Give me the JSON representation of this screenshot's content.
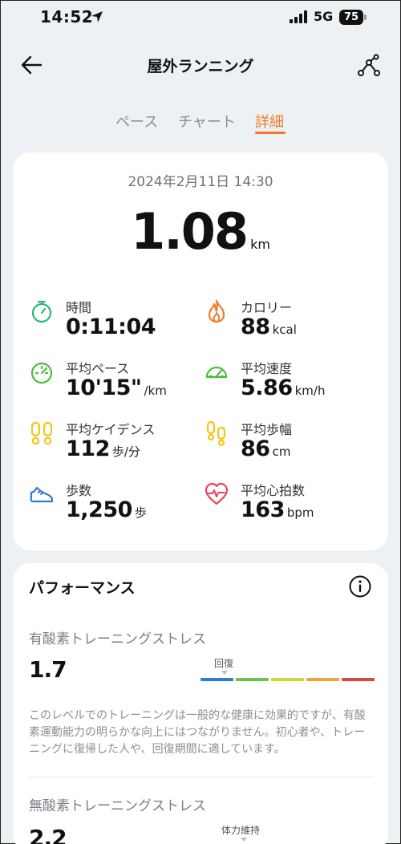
{
  "status_bar": {
    "time": "14:52",
    "network": "5G",
    "battery": "75"
  },
  "header": {
    "title": "屋外ランニング"
  },
  "tabs": [
    {
      "label": "ペース",
      "active": false
    },
    {
      "label": "チャート",
      "active": false
    },
    {
      "label": "詳細",
      "active": true
    }
  ],
  "summary": {
    "date": "2024年2月11日 14:30",
    "distance": "1.08",
    "distance_unit": "km"
  },
  "metrics": [
    {
      "label": "時間",
      "value": "0:11:04",
      "unit": "",
      "icon": "stopwatch-icon",
      "color": "#2bb673"
    },
    {
      "label": "カロリー",
      "value": "88",
      "unit": "kcal",
      "icon": "flame-icon",
      "color": "#f07a2a"
    },
    {
      "label": "平均ペース",
      "value": "10'15\"",
      "unit": "/km",
      "icon": "speedometer-icon",
      "color": "#4cbb3c"
    },
    {
      "label": "平均速度",
      "value": "5.86",
      "unit": "km/h",
      "icon": "speedometer-icon",
      "color": "#4cbb3c"
    },
    {
      "label": "平均ケイデンス",
      "value": "112",
      "unit": "歩/分",
      "icon": "footprints-icon",
      "color": "#f5c518"
    },
    {
      "label": "平均歩幅",
      "value": "86",
      "unit": "cm",
      "icon": "footprints-icon",
      "color": "#f5c518"
    },
    {
      "label": "歩数",
      "value": "1,250",
      "unit": "歩",
      "icon": "shoe-icon",
      "color": "#2f7bd8"
    },
    {
      "label": "平均心拍数",
      "value": "163",
      "unit": "bpm",
      "icon": "heart-pulse-icon",
      "color": "#e8445a"
    }
  ],
  "performance": {
    "title": "パフォーマンス",
    "aerobic": {
      "title": "有酸素トレーニングストレス",
      "value": "1.7",
      "level_label": "回復",
      "description": "このレベルでのトレーニングは一般的な健康に効果的ですが、有酸素運動能力の明らかな向上にはつながりません。初心者や、トレーニングに復帰した人や、回復期間に適しています。"
    },
    "anaerobic": {
      "title": "無酸素トレーニングストレス",
      "value": "2.2",
      "level_label": "体力維持"
    },
    "scale_colors": [
      "#2f7bd8",
      "#6cc24a",
      "#c8d63a",
      "#f2a33a",
      "#e0443a"
    ]
  }
}
